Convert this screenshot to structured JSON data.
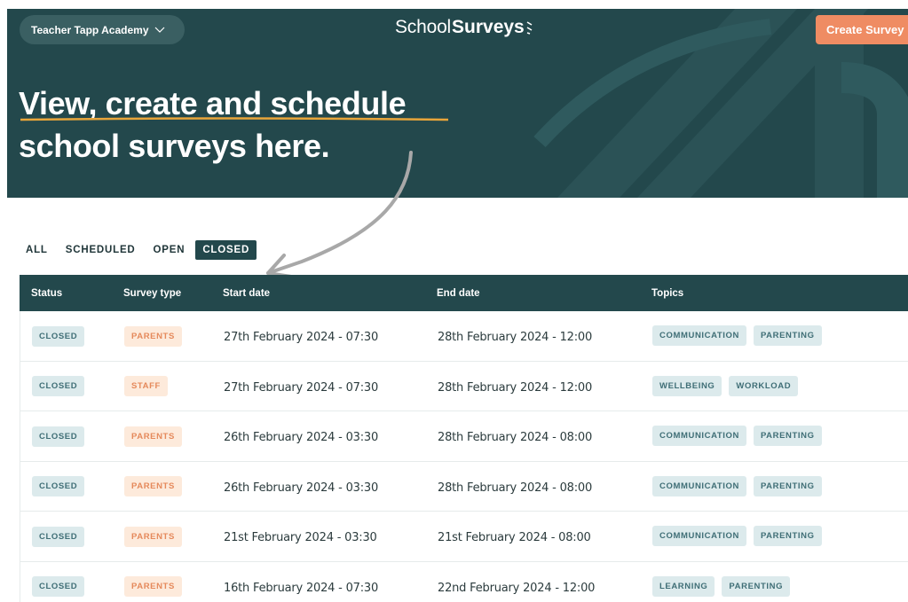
{
  "header": {
    "org_name": "Teacher Tapp Academy",
    "logo_part1": "School",
    "logo_part2": "Surveys",
    "create_button": "Create Survey",
    "headline_line1": "View, create and schedule",
    "headline_line2": "school surveys here."
  },
  "colors": {
    "brand_dark": "#23484c",
    "accent_orange": "#ef8c63",
    "underline_gold": "#e8a53a",
    "badge_teal_bg": "#dceaec",
    "badge_orange_bg": "#fdeadb"
  },
  "filters": [
    {
      "label": "ALL",
      "active": false
    },
    {
      "label": "SCHEDULED",
      "active": false
    },
    {
      "label": "OPEN",
      "active": false
    },
    {
      "label": "CLOSED",
      "active": true
    }
  ],
  "table": {
    "columns": [
      "Status",
      "Survey type",
      "Start date",
      "End date",
      "Topics"
    ],
    "rows": [
      {
        "status": "CLOSED",
        "type": "PARENTS",
        "start": "27th February 2024 - 07:30",
        "end": "28th February 2024 - 12:00",
        "topics": [
          "COMMUNICATION",
          "PARENTING"
        ]
      },
      {
        "status": "CLOSED",
        "type": "STAFF",
        "start": "27th February 2024 - 07:30",
        "end": "28th February 2024 - 12:00",
        "topics": [
          "WELLBEING",
          "WORKLOAD"
        ]
      },
      {
        "status": "CLOSED",
        "type": "PARENTS",
        "start": "26th February 2024 - 03:30",
        "end": "28th February 2024 - 08:00",
        "topics": [
          "COMMUNICATION",
          "PARENTING"
        ]
      },
      {
        "status": "CLOSED",
        "type": "PARENTS",
        "start": "26th February 2024 - 03:30",
        "end": "28th February 2024 - 08:00",
        "topics": [
          "COMMUNICATION",
          "PARENTING"
        ]
      },
      {
        "status": "CLOSED",
        "type": "PARENTS",
        "start": "21st February 2024 - 03:30",
        "end": "21st February 2024 - 08:00",
        "topics": [
          "COMMUNICATION",
          "PARENTING"
        ]
      },
      {
        "status": "CLOSED",
        "type": "PARENTS",
        "start": "16th February 2024 - 07:30",
        "end": "22nd February 2024 - 12:00",
        "topics": [
          "LEARNING",
          "PARENTING"
        ]
      }
    ]
  }
}
